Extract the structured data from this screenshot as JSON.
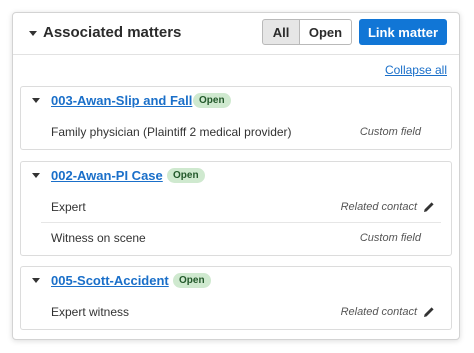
{
  "panel": {
    "title": "Associated matters",
    "filter_all": "All",
    "filter_open": "Open",
    "link_button": "Link matter",
    "collapse_all": "Collapse all"
  },
  "matters": [
    {
      "name": "003-Awan-Slip and Fall",
      "status": "Open",
      "rows": [
        {
          "label": "Family physician (Plaintiff 2 medical provider)",
          "type": "Custom field",
          "icon": ""
        }
      ]
    },
    {
      "name": "002-Awan-PI Case",
      "status": "Open",
      "rows": [
        {
          "label": "Expert",
          "type": "Related contact",
          "icon": "pencil-icon"
        },
        {
          "label": "Witness on scene",
          "type": "Custom field",
          "icon": ""
        }
      ]
    },
    {
      "name": "005-Scott-Accident",
      "status": "Open",
      "rows": [
        {
          "label": "Expert witness",
          "type": "Related contact",
          "icon": "pencil-icon"
        }
      ]
    }
  ],
  "colors": {
    "primary": "#1176d6",
    "link": "#1a6fc9",
    "badge_bg": "#cfe9cf",
    "badge_text": "#22582a"
  }
}
